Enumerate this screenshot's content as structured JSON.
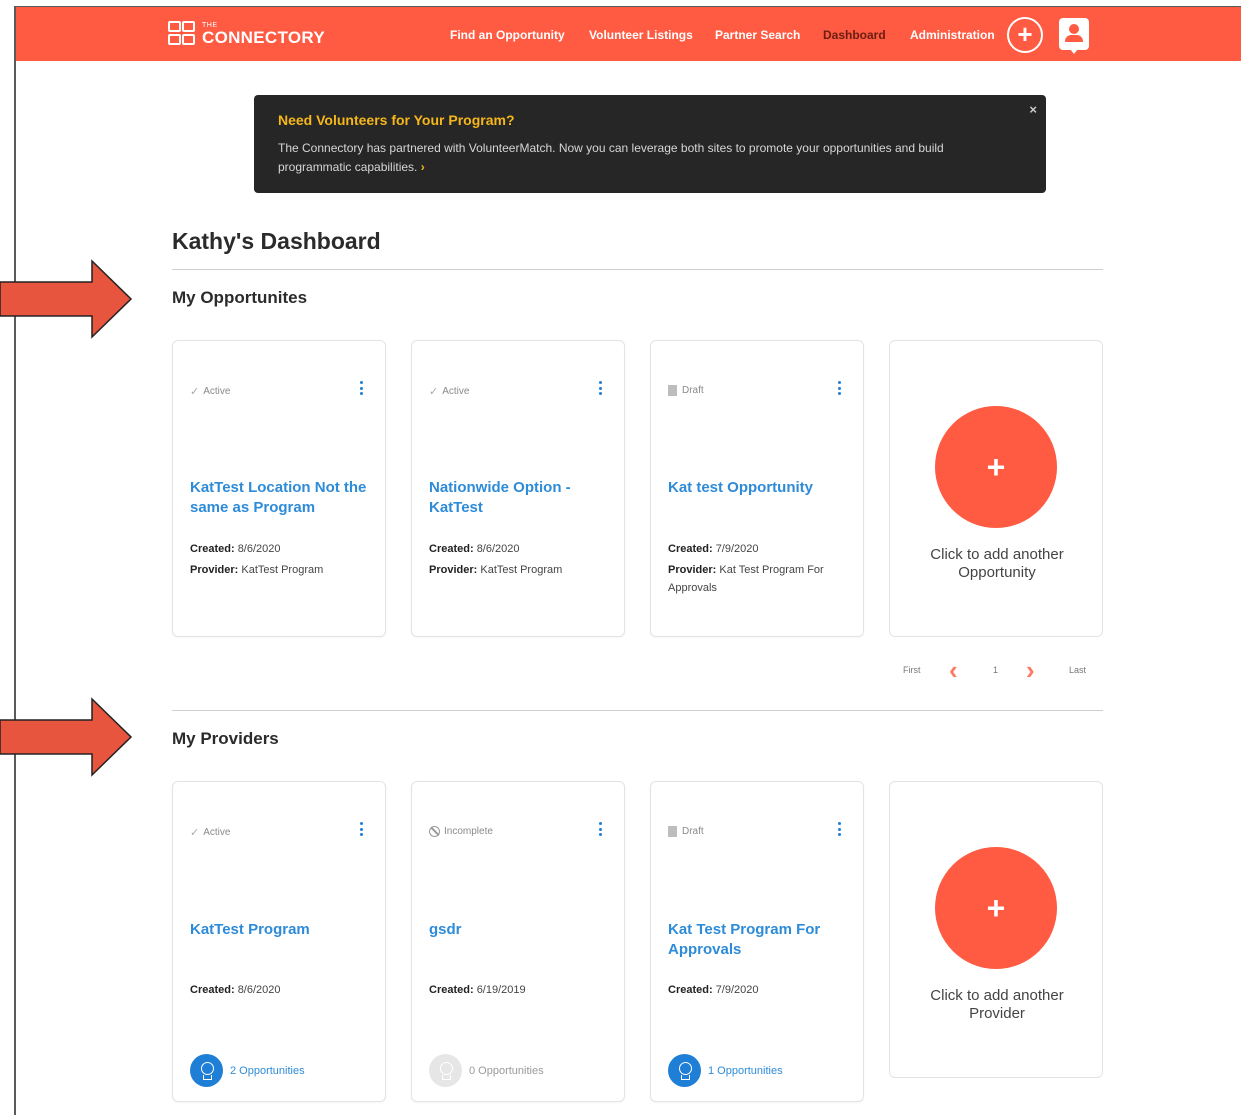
{
  "header": {
    "logo_small": "THE",
    "logo_name": "CONNECTORY",
    "nav": [
      "Find an Opportunity",
      "Volunteer Listings",
      "Partner Search",
      "Dashboard",
      "Administration"
    ],
    "active_nav": "Dashboard",
    "add_symbol": "+"
  },
  "banner": {
    "title": "Need Volunteers for Your Program?",
    "text": "The Connectory has partnered with VolunteerMatch. Now you can leverage both sites to promote your opportunities and build programmatic capabilities.",
    "link_chevron": "›",
    "close": "×"
  },
  "dashboard_title": "Kathy's Dashboard",
  "opportunities": {
    "title": "My Opportunites",
    "cards": [
      {
        "status": "Active",
        "status_icon": "check-icon",
        "title": "KatTest Location Not the same as Program",
        "created_label": "Created:",
        "created": "8/6/2020",
        "provider_label": "Provider:",
        "provider": "KatTest Program"
      },
      {
        "status": "Active",
        "status_icon": "check-icon",
        "title": "Nationwide Option - KatTest",
        "created_label": "Created:",
        "created": "8/6/2020",
        "provider_label": "Provider:",
        "provider": "KatTest Program"
      },
      {
        "status": "Draft",
        "status_icon": "document-icon",
        "title": "Kat test Opportunity",
        "created_label": "Created:",
        "created": "7/9/2020",
        "provider_label": "Provider:",
        "provider": "Kat Test Program For Approvals"
      }
    ],
    "add_label": "Click to add another Opportunity",
    "pager": {
      "first": "First",
      "page": "1",
      "last": "Last",
      "prev": "‹",
      "next": "›"
    }
  },
  "providers": {
    "title": "My Providers",
    "cards": [
      {
        "status": "Active",
        "status_icon": "check-icon",
        "title": "KatTest Program",
        "created_label": "Created:",
        "created": "8/6/2020",
        "opportunities": "2 Opportunities"
      },
      {
        "status": "Incomplete",
        "status_icon": "ban-icon",
        "title": "gsdr",
        "created_label": "Created:",
        "created": "6/19/2019",
        "opportunities": "0 Opportunities"
      },
      {
        "status": "Draft",
        "status_icon": "document-icon",
        "title": "Kat Test Program For Approvals",
        "created_label": "Created:",
        "created": "7/9/2020",
        "opportunities": "1 Opportunities"
      }
    ],
    "add_label": "Click to add another Provider"
  },
  "colors": {
    "brand": "#ff5a42",
    "link": "#2e8bd8",
    "banner_bg": "#262626",
    "banner_title": "#f5b71a",
    "annotation_arrow": "#e8553e"
  }
}
